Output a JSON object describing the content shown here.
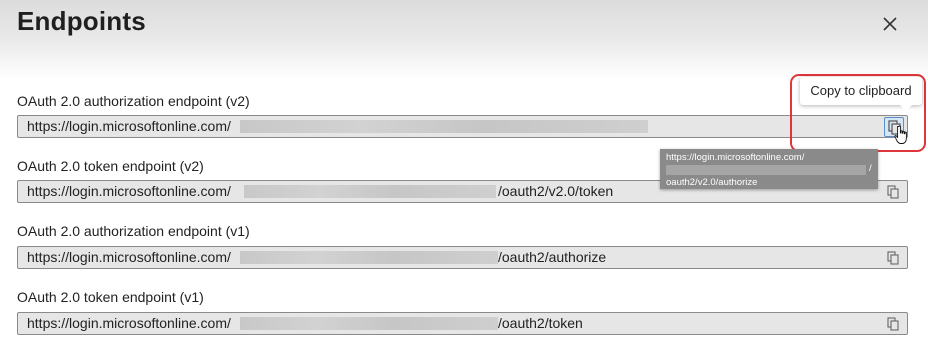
{
  "panel": {
    "title": "Endpoints",
    "close_label": "Close"
  },
  "endpoints": [
    {
      "label": "OAuth 2.0 authorization endpoint (v2)",
      "url_prefix": "https://login.microsoftonline.com/",
      "url_suffix": ""
    },
    {
      "label": "OAuth 2.0 token endpoint (v2)",
      "url_prefix": "https://login.microsoftonline.com/",
      "url_suffix": "/oauth2/v2.0/token"
    },
    {
      "label": "OAuth 2.0 authorization endpoint (v1)",
      "url_prefix": "https://login.microsoftonline.com/",
      "url_suffix": "/oauth2/authorize"
    },
    {
      "label": "OAuth 2.0 token endpoint (v1)",
      "url_prefix": "https://login.microsoftonline.com/",
      "url_suffix": "/oauth2/token"
    }
  ],
  "tooltip": {
    "text": "Copy to clipboard"
  },
  "url_tooltip": {
    "line1": "https://login.microsoftonline.com/",
    "line2_end": "/",
    "line3": "oauth2/v2.0/authorize"
  },
  "colors": {
    "highlight": "#e0363b",
    "field_bg": "#e6e6e6",
    "active_copy_bg": "#d6e6f5"
  }
}
